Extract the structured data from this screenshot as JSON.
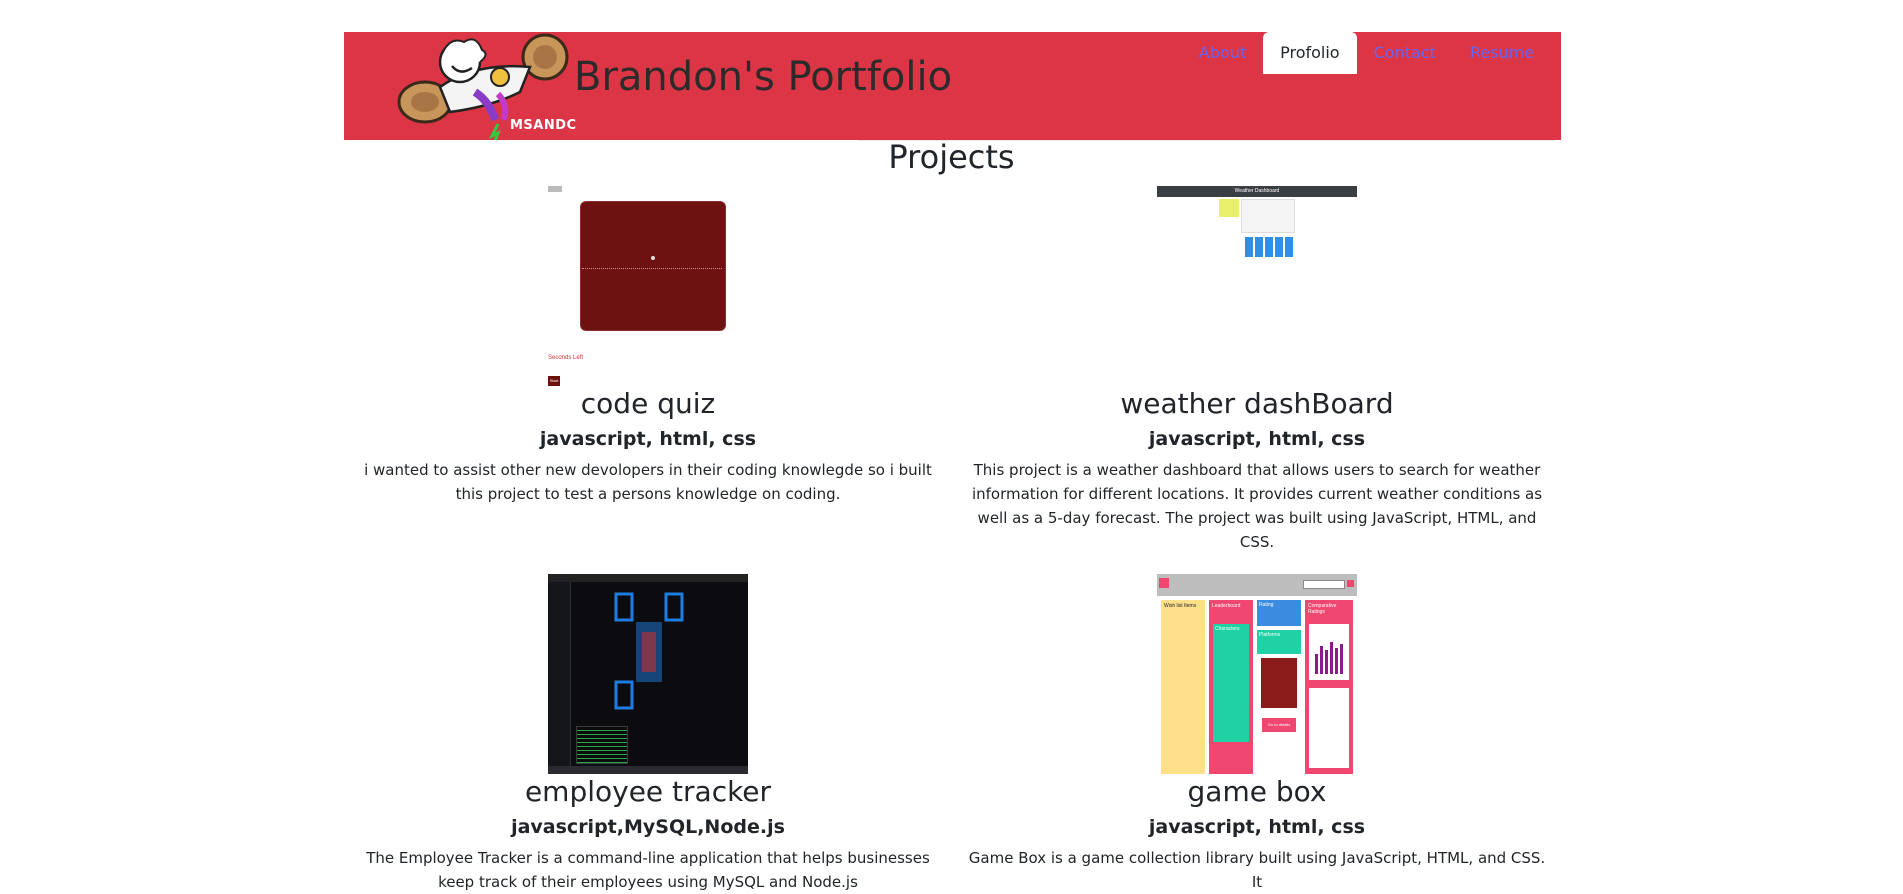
{
  "header": {
    "brand": "Brandon's Portfolio",
    "logo_caption": "MSANDC",
    "nav": [
      "About",
      "Profolio",
      "Contact",
      "Resume"
    ],
    "active_nav": "Profolio"
  },
  "projects_section": {
    "title": "Projects",
    "cards": [
      {
        "title": "code quiz",
        "tech": "javascript, html, css",
        "description": "i wanted to assist other new devolopers in their coding knowlegde so i built this project to test a persons knowledge on coding.",
        "thumbnail_labels": [
          "Seconds Left",
          "Start"
        ]
      },
      {
        "title": "weather dashBoard",
        "tech": "javascript, html, css",
        "description": "This project is a weather dashboard that allows users to search for weather information for different locations. It provides current weather conditions as well as a 5-day forecast. The project was built using JavaScript, HTML, and CSS.",
        "thumbnail_labels": [
          "Weather Dashboard"
        ]
      },
      {
        "title": "employee tracker",
        "tech": "javascript,MySQL,Node.js",
        "description": "The Employee Tracker is a command-line application that helps businesses keep track of their employees using MySQL and Node.js",
        "thumbnail_labels": []
      },
      {
        "title": "game box",
        "tech": "javascript, html, css",
        "description": "Game Box is a game collection library built using JavaScript, HTML, and CSS. It",
        "thumbnail_labels": [
          "Wish list Items",
          "Leaderboard",
          "Rating",
          "Comparative Ratings",
          "Characters",
          "Platforms",
          "Go to details"
        ]
      }
    ]
  },
  "colors": {
    "header_bg": "#dc3545",
    "nav_link": "#6a63ee",
    "active_tab_bg": "#ffffff",
    "quiz_card": "#6e1111",
    "game_yellow": "#ffe08a",
    "game_pink": "#f04770",
    "game_teal": "#1fd1a4",
    "game_blue": "#3b8be0"
  }
}
